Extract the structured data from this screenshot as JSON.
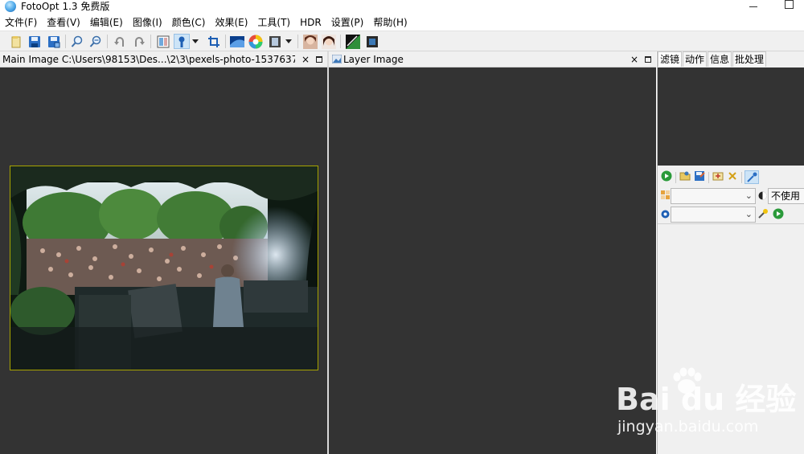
{
  "window": {
    "title": "FotoOpt 1.3 免费版"
  },
  "menu": [
    "文件(F)",
    "查看(V)",
    "编辑(E)",
    "图像(I)",
    "颜色(C)",
    "效果(E)",
    "工具(T)",
    "HDR",
    "设置(P)",
    "帮助(H)"
  ],
  "toolbar": {
    "icons": [
      "open-icon",
      "save-icon",
      "save-as-icon",
      "zoom-in-icon",
      "zoom-out-icon",
      "undo-icon",
      "redo-icon",
      "compare-icon",
      "brush-icon",
      "crop-icon",
      "levels-icon",
      "color-wheel-icon",
      "filmstrip-icon",
      "portrait-icon",
      "face-retouch-icon",
      "gradient-icon",
      "image-frame-icon"
    ]
  },
  "main_panel": {
    "title": "Main Image C:\\Users\\98153\\Des...\\2\\3\\pexels-photo-1537637.jpg",
    "close": "×"
  },
  "layer_panel": {
    "title": "Layer Image",
    "close": "×"
  },
  "right_panel": {
    "tabs": [
      "滤镜",
      "动作",
      "信息",
      "批处理"
    ],
    "active_tab": "滤镜",
    "blend_mode_value": "",
    "mask_label": "不使用",
    "second_combo_value": ""
  },
  "watermark": {
    "main": "Bai du 经验",
    "sub": "jingyan.baidu.com"
  },
  "colors": {
    "canvas": "#333333",
    "frame": "#a7a300",
    "chrome": "#f0f0f0"
  }
}
